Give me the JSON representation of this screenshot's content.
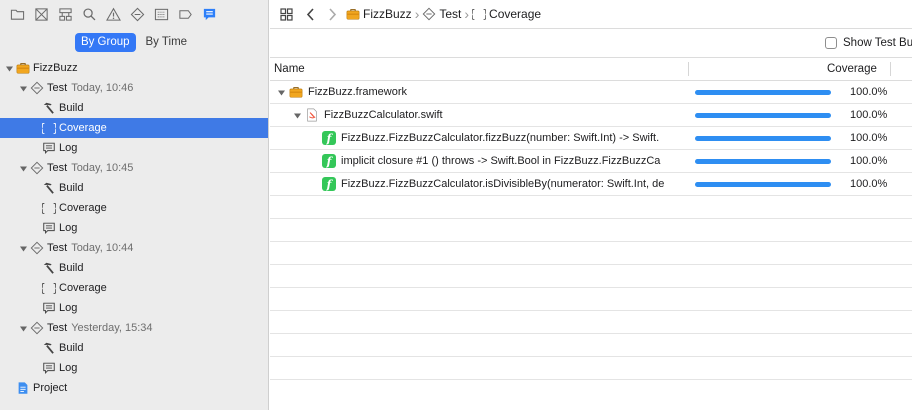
{
  "navigator": {
    "icons": [
      "folder-icon",
      "source-control-icon",
      "hierarchy-icon",
      "search-icon",
      "warning-icon",
      "test-diamond-icon",
      "debug-list-icon",
      "breakpoint-icon",
      "report-icon"
    ],
    "segments": [
      "By Group",
      "By Time"
    ],
    "active_segment": 0
  },
  "tree": [
    {
      "level": 0,
      "disclosure": "open",
      "icon": "briefcase-icon",
      "label": "FizzBuzz",
      "sub": ""
    },
    {
      "level": 1,
      "disclosure": "open",
      "icon": "test-diamond-icon",
      "label": "Test",
      "sub": "Today, 10:46"
    },
    {
      "level": 2,
      "disclosure": "",
      "icon": "hammer-icon",
      "label": "Build",
      "sub": ""
    },
    {
      "level": 2,
      "disclosure": "",
      "icon": "braces-icon",
      "label": "Coverage",
      "sub": "",
      "selected": true
    },
    {
      "level": 2,
      "disclosure": "",
      "icon": "log-icon",
      "label": "Log",
      "sub": ""
    },
    {
      "level": 1,
      "disclosure": "open",
      "icon": "test-diamond-icon",
      "label": "Test",
      "sub": "Today, 10:45"
    },
    {
      "level": 2,
      "disclosure": "",
      "icon": "hammer-icon",
      "label": "Build",
      "sub": ""
    },
    {
      "level": 2,
      "disclosure": "",
      "icon": "braces-icon",
      "label": "Coverage",
      "sub": ""
    },
    {
      "level": 2,
      "disclosure": "",
      "icon": "log-icon",
      "label": "Log",
      "sub": ""
    },
    {
      "level": 1,
      "disclosure": "open",
      "icon": "test-diamond-icon",
      "label": "Test",
      "sub": "Today, 10:44"
    },
    {
      "level": 2,
      "disclosure": "",
      "icon": "hammer-icon",
      "label": "Build",
      "sub": ""
    },
    {
      "level": 2,
      "disclosure": "",
      "icon": "braces-icon",
      "label": "Coverage",
      "sub": ""
    },
    {
      "level": 2,
      "disclosure": "",
      "icon": "log-icon",
      "label": "Log",
      "sub": ""
    },
    {
      "level": 1,
      "disclosure": "open",
      "icon": "test-diamond-icon",
      "label": "Test",
      "sub": "Yesterday, 15:34"
    },
    {
      "level": 2,
      "disclosure": "",
      "icon": "hammer-icon",
      "label": "Build",
      "sub": ""
    },
    {
      "level": 2,
      "disclosure": "",
      "icon": "log-icon",
      "label": "Log",
      "sub": ""
    },
    {
      "level": 0,
      "disclosure": "",
      "icon": "project-icon",
      "label": "Project",
      "sub": ""
    }
  ],
  "jumpbar": {
    "crumbs": [
      {
        "icon": "briefcase-icon",
        "label": "FizzBuzz"
      },
      {
        "icon": "test-diamond-icon",
        "label": "Test"
      },
      {
        "icon": "braces-icon",
        "label": "Coverage"
      }
    ]
  },
  "options": {
    "show_test_label": "Show Test Bu"
  },
  "table": {
    "columns": {
      "name": "Name",
      "coverage": "Coverage"
    },
    "rows": [
      {
        "level": 0,
        "disclosure": "open",
        "icon": "briefcase-icon",
        "name": "FizzBuzz.framework",
        "coverage": 1.0,
        "pct": "100.0%"
      },
      {
        "level": 1,
        "disclosure": "open",
        "icon": "swift-file-icon",
        "name": "FizzBuzzCalculator.swift",
        "coverage": 1.0,
        "pct": "100.0%"
      },
      {
        "level": 2,
        "disclosure": "",
        "icon": "function-icon",
        "name": "FizzBuzz.FizzBuzzCalculator.fizzBuzz(number: Swift.Int) -> Swift.",
        "coverage": 1.0,
        "pct": "100.0%"
      },
      {
        "level": 2,
        "disclosure": "",
        "icon": "function-icon",
        "name": "implicit closure #1 () throws -> Swift.Bool in FizzBuzz.FizzBuzzCa",
        "coverage": 1.0,
        "pct": "100.0%"
      },
      {
        "level": 2,
        "disclosure": "",
        "icon": "function-icon",
        "name": "FizzBuzz.FizzBuzzCalculator.isDivisibleBy(numerator: Swift.Int, de",
        "coverage": 1.0,
        "pct": "100.0%"
      }
    ],
    "empty_rows": 8
  },
  "colors": {
    "accent": "#3478f6",
    "selection": "#3f7ae6",
    "bar": "#2e8ef2",
    "function": "#34c759"
  }
}
